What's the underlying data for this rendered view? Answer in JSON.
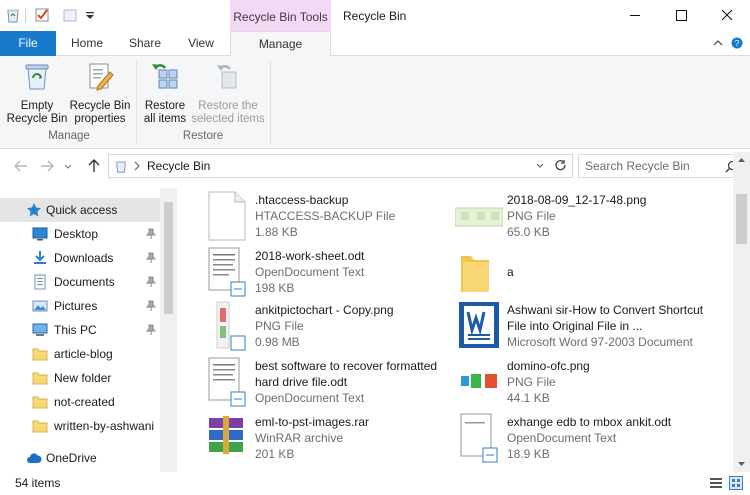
{
  "window": {
    "title": "Recycle Bin",
    "context_tab_title": "Recycle Bin Tools"
  },
  "ribbon": {
    "tabs": {
      "file": "File",
      "home": "Home",
      "share": "Share",
      "view": "View",
      "manage": "Manage"
    },
    "empty_bin": [
      "Empty",
      "Recycle Bin"
    ],
    "bin_props": [
      "Recycle Bin",
      "properties"
    ],
    "restore_all": [
      "Restore",
      "all items"
    ],
    "restore_selected": [
      "Restore the",
      "selected items"
    ],
    "group_manage": "Manage",
    "group_restore": "Restore"
  },
  "address": {
    "path": "Recycle Bin",
    "search_placeholder": "Search Recycle Bin"
  },
  "nav": {
    "items": [
      {
        "label": "Quick access",
        "icon": "star-icon",
        "pinned": false
      },
      {
        "label": "Desktop",
        "icon": "desktop-icon",
        "pinned": true
      },
      {
        "label": "Downloads",
        "icon": "download-icon",
        "pinned": true
      },
      {
        "label": "Documents",
        "icon": "documents-icon",
        "pinned": true
      },
      {
        "label": "Pictures",
        "icon": "pictures-icon",
        "pinned": true
      },
      {
        "label": "This PC",
        "icon": "computer-icon",
        "pinned": true
      },
      {
        "label": "article-blog",
        "icon": "folder-icon",
        "pinned": false
      },
      {
        "label": "New folder",
        "icon": "folder-icon",
        "pinned": false
      },
      {
        "label": "not-created",
        "icon": "folder-icon",
        "pinned": false
      },
      {
        "label": "written-by-ashwani",
        "icon": "folder-icon",
        "pinned": false
      },
      {
        "label": "OneDrive",
        "icon": "cloud-icon",
        "pinned": false
      }
    ]
  },
  "files": [
    {
      "name": ".htaccess-backup",
      "type": "HTACCESS-BACKUP File",
      "size": "1.88 KB",
      "icon": "blank-file-icon"
    },
    {
      "name": "2018-08-09_12-17-48.png",
      "type": "PNG File",
      "size": "65.0 KB",
      "icon": "image-thumb-icon"
    },
    {
      "name": "2018-work-sheet.odt",
      "type": "OpenDocument Text",
      "size": "198 KB",
      "icon": "document-icon"
    },
    {
      "name": "a",
      "type": "",
      "size": "",
      "icon": "folder-icon"
    },
    {
      "name": "ankitpictochart - Copy.png",
      "type": "PNG File",
      "size": "0.98 MB",
      "icon": "image-thumb-icon"
    },
    {
      "name": "Ashwani sir-How to Convert Shortcut File into Original File in ...",
      "type": "Microsoft Word 97-2003 Document",
      "size": "",
      "icon": "word-doc-icon"
    },
    {
      "name": "best software to recover formatted hard drive file.odt",
      "type": "OpenDocument Text",
      "size": "",
      "icon": "document-icon"
    },
    {
      "name": "domino-ofc.png",
      "type": "PNG File",
      "size": "44.1 KB",
      "icon": "image-thumb-icon"
    },
    {
      "name": "eml-to-pst-images.rar",
      "type": "WinRAR archive",
      "size": "201 KB",
      "icon": "rar-archive-icon"
    },
    {
      "name": "exhange edb to mbox ankit.odt",
      "type": "OpenDocument Text",
      "size": "18.9 KB",
      "icon": "document-icon"
    }
  ],
  "status": {
    "count": "54 items"
  },
  "colors": {
    "accent": "#1979ca",
    "context_tab": "#f4d9f7",
    "selected_nav": "#e5e5e5",
    "folder": "#f8d775"
  }
}
